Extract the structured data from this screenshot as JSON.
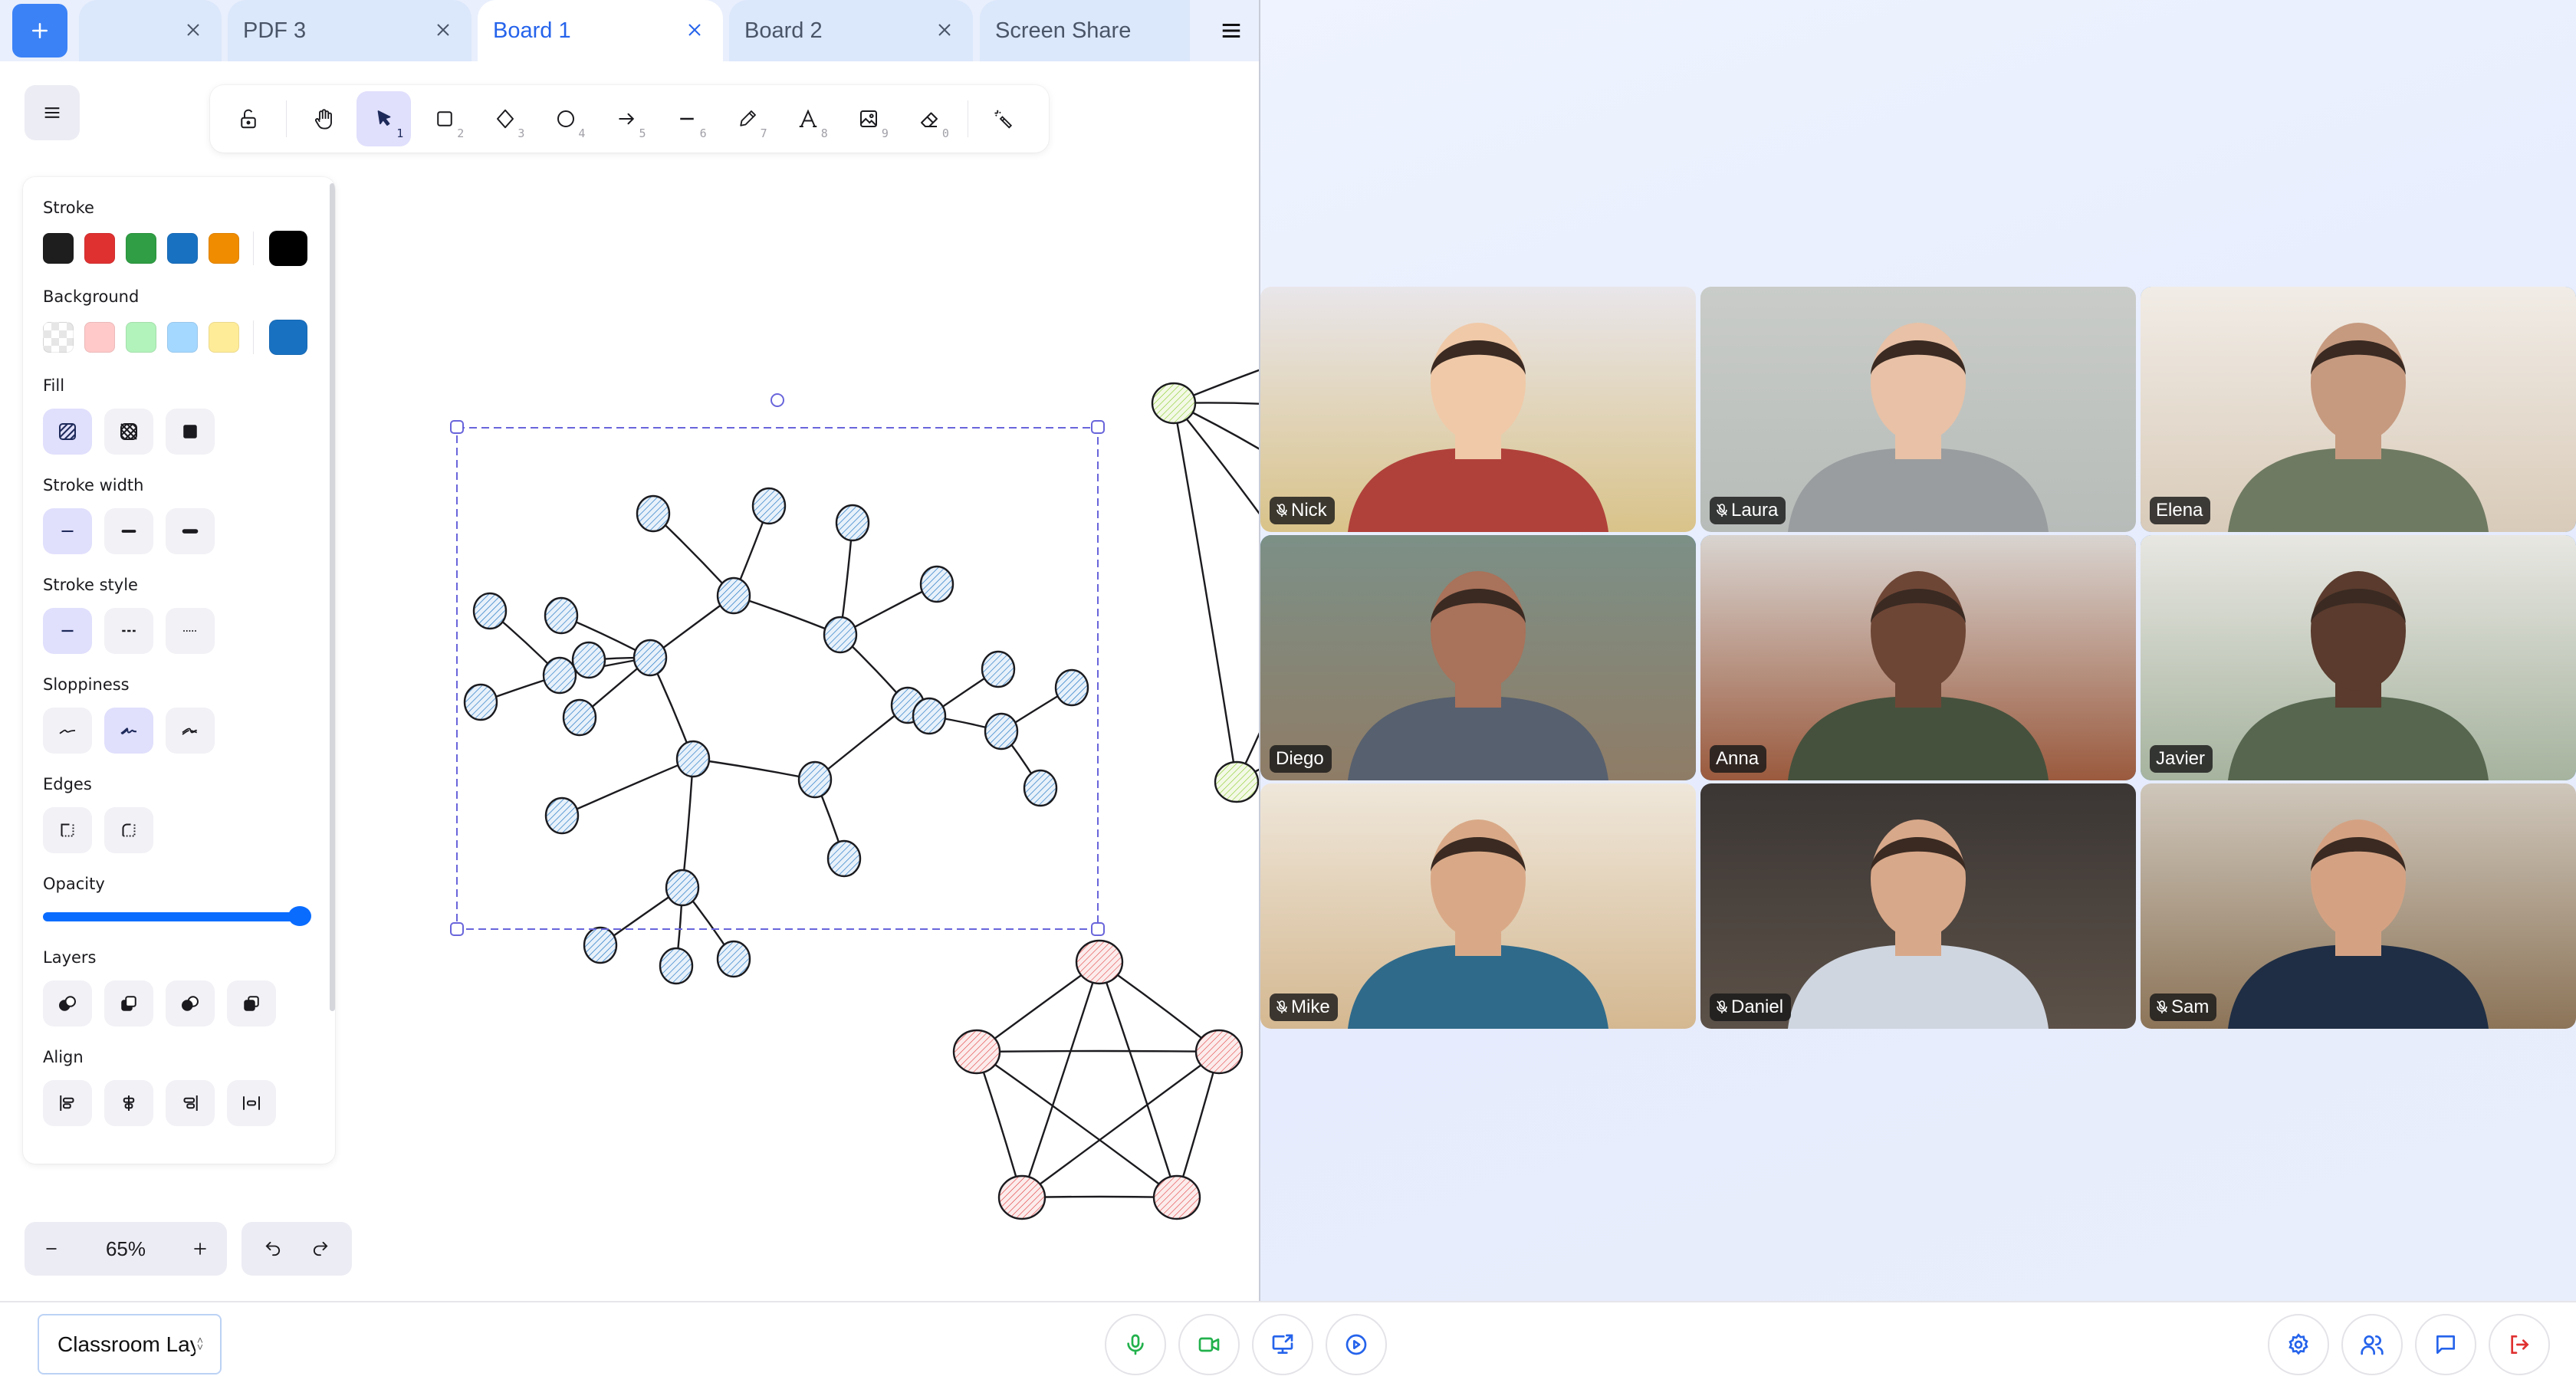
{
  "tabs": {
    "add_label": "+",
    "items": [
      {
        "label": "",
        "active": false
      },
      {
        "label": "PDF 3",
        "active": false
      },
      {
        "label": "Board 1",
        "active": true
      },
      {
        "label": "Board 2",
        "active": false
      },
      {
        "label": "Screen Share",
        "active": false
      }
    ]
  },
  "toolbar": {
    "tools": [
      {
        "name": "lock",
        "icon": "unlock-icon",
        "key": ""
      },
      {
        "name": "hand",
        "icon": "hand-icon",
        "key": ""
      },
      {
        "name": "selection",
        "icon": "pointer-icon",
        "key": "1",
        "active": true
      },
      {
        "name": "rectangle",
        "icon": "rectangle-icon",
        "key": "2"
      },
      {
        "name": "diamond",
        "icon": "diamond-icon",
        "key": "3"
      },
      {
        "name": "ellipse",
        "icon": "ellipse-icon",
        "key": "4"
      },
      {
        "name": "arrow",
        "icon": "arrow-icon",
        "key": "5"
      },
      {
        "name": "line",
        "icon": "line-icon",
        "key": "6"
      },
      {
        "name": "draw",
        "icon": "pencil-icon",
        "key": "7"
      },
      {
        "name": "text",
        "icon": "text-icon",
        "key": "8"
      },
      {
        "name": "image",
        "icon": "image-icon",
        "key": "9"
      },
      {
        "name": "eraser",
        "icon": "eraser-icon",
        "key": "0"
      },
      {
        "name": "laser",
        "icon": "laser-pointer-icon",
        "key": ""
      }
    ]
  },
  "properties": {
    "stroke": {
      "label": "Stroke",
      "colors": [
        "#1e1e1e",
        "#e03131",
        "#2f9e44",
        "#1971c2",
        "#f08c00"
      ],
      "current": "#000000"
    },
    "background": {
      "label": "Background",
      "colors": [
        "transparent",
        "#ffc9c9",
        "#b2f2bb",
        "#a5d8ff",
        "#ffec99"
      ],
      "current": "#1971c2"
    },
    "fill": {
      "label": "Fill",
      "options": [
        "hachure",
        "cross-hatch",
        "solid"
      ],
      "selected": "hachure"
    },
    "stroke_width": {
      "label": "Stroke width",
      "options": [
        "thin",
        "bold",
        "extra-bold"
      ],
      "selected": "thin"
    },
    "stroke_style": {
      "label": "Stroke style",
      "options": [
        "solid",
        "dashed",
        "dotted"
      ],
      "selected": "solid"
    },
    "sloppiness": {
      "label": "Sloppiness",
      "options": [
        "architect",
        "artist",
        "cartoonist"
      ],
      "selected": "artist"
    },
    "edges": {
      "label": "Edges",
      "options": [
        "sharp",
        "round"
      ]
    },
    "opacity": {
      "label": "Opacity",
      "value": 100
    },
    "layers": {
      "label": "Layers",
      "options": [
        "send-to-back",
        "send-backward",
        "bring-forward",
        "bring-to-front"
      ]
    },
    "align": {
      "label": "Align",
      "options": [
        "align-left",
        "align-center",
        "align-right",
        "distribute"
      ]
    }
  },
  "zoom": {
    "value": "65%",
    "minus": "−",
    "plus": "+"
  },
  "canvas": {
    "tree_color": "#1971c2",
    "pentagon_color": "#e03131",
    "side_graph_color": "#82c91e"
  },
  "participants": [
    {
      "name": "Nick",
      "muted": true,
      "speaking": false
    },
    {
      "name": "Laura",
      "muted": true,
      "speaking": false
    },
    {
      "name": "Elena",
      "muted": false,
      "speaking": true
    },
    {
      "name": "Diego",
      "muted": false,
      "speaking": true
    },
    {
      "name": "Anna",
      "muted": false,
      "speaking": true
    },
    {
      "name": "Javier",
      "muted": false,
      "speaking": true
    },
    {
      "name": "Mike",
      "muted": true,
      "speaking": false
    },
    {
      "name": "Daniel",
      "muted": true,
      "speaking": false
    },
    {
      "name": "Sam",
      "muted": true,
      "speaking": false
    }
  ],
  "bottom_bar": {
    "classroom_select": "Classroom Layout",
    "left_controls": [
      {
        "name": "microphone",
        "color": "#22b14c"
      },
      {
        "name": "camera",
        "color": "#22b14c"
      },
      {
        "name": "share-screen",
        "color": "#2563eb"
      },
      {
        "name": "record",
        "color": "#2563eb"
      }
    ],
    "right_controls": [
      {
        "name": "settings",
        "color": "#2563eb"
      },
      {
        "name": "participants",
        "color": "#2563eb"
      },
      {
        "name": "chat",
        "color": "#2563eb"
      },
      {
        "name": "leave",
        "color": "#e03131"
      }
    ]
  }
}
